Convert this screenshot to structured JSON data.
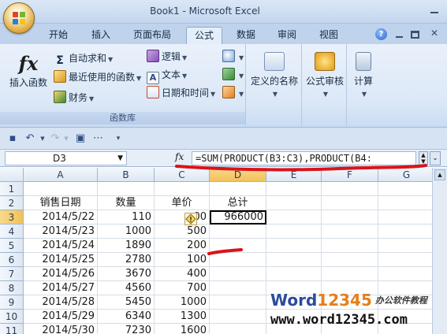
{
  "window": {
    "title": "Book1 - Microsoft Excel"
  },
  "tabs": [
    "开始",
    "插入",
    "页面布局",
    "公式",
    "数据",
    "审阅",
    "视图"
  ],
  "active_tab": "公式",
  "ribbon": {
    "insert_function": "插入函数",
    "autosum": "自动求和",
    "recent": "最近使用的函数",
    "financial": "财务",
    "logical": "逻辑",
    "text": "文本",
    "datetime": "日期和时间",
    "group_label": "函数库",
    "defined_names": "定义的名称",
    "audit": "公式审核",
    "calc": "计算"
  },
  "formula_bar": {
    "name_box": "D3",
    "fx": "fx",
    "formula": "=SUM(PRODUCT(B3:C3),PRODUCT(B4:"
  },
  "grid": {
    "columns": [
      "A",
      "B",
      "C",
      "D",
      "E",
      "F",
      "G"
    ],
    "rows": [
      {
        "n": "1",
        "a": "",
        "b": "",
        "c": "",
        "d": ""
      },
      {
        "n": "2",
        "a": "销售日期",
        "b": "数量",
        "c": "单价",
        "d": "总计"
      },
      {
        "n": "3",
        "a": "2014/5/22",
        "b": "110",
        "c": "00",
        "d": "966000"
      },
      {
        "n": "4",
        "a": "2014/5/23",
        "b": "1000",
        "c": "500",
        "d": ""
      },
      {
        "n": "5",
        "a": "2014/5/24",
        "b": "1890",
        "c": "200",
        "d": ""
      },
      {
        "n": "6",
        "a": "2014/5/25",
        "b": "2780",
        "c": "100",
        "d": ""
      },
      {
        "n": "7",
        "a": "2014/5/26",
        "b": "3670",
        "c": "400",
        "d": ""
      },
      {
        "n": "8",
        "a": "2014/5/27",
        "b": "4560",
        "c": "700",
        "d": ""
      },
      {
        "n": "9",
        "a": "2014/5/28",
        "b": "5450",
        "c": "1000",
        "d": ""
      },
      {
        "n": "10",
        "a": "2014/5/29",
        "b": "6340",
        "c": "1300",
        "d": ""
      },
      {
        "n": "11",
        "a": "2014/5/30",
        "b": "7230",
        "c": "1600",
        "d": ""
      }
    ]
  },
  "watermark": {
    "word": "Word",
    "num": "12345",
    "cn": "办公软件教程",
    "url": "www.word12345.com"
  }
}
